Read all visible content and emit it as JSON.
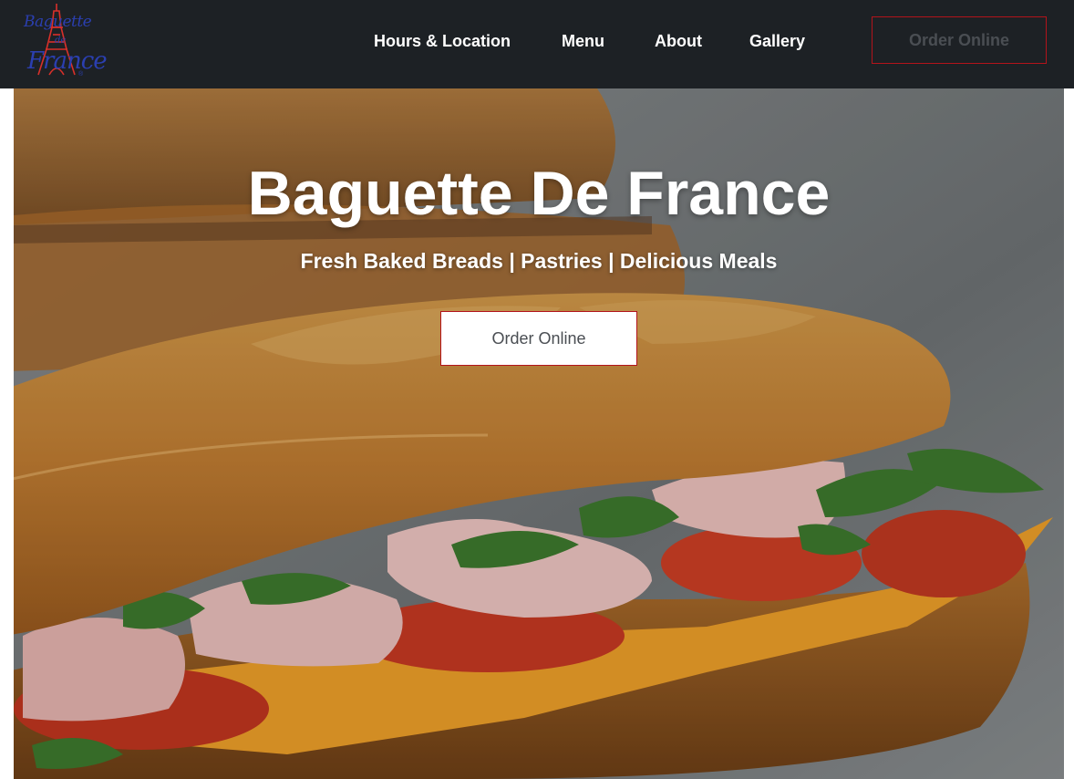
{
  "brand": {
    "logo_line1": "Baguette",
    "logo_line2": "de",
    "logo_line3": "France",
    "logo_mark": "®"
  },
  "nav": {
    "links": [
      {
        "label": "Hours & Location"
      },
      {
        "label": "Menu"
      },
      {
        "label": "About"
      },
      {
        "label": "Gallery"
      }
    ],
    "order_button": "Order Online"
  },
  "hero": {
    "title": "Baguette De France",
    "subtitle": "Fresh Baked Breads | Pastries | Delicious Meals",
    "button": "Order Online",
    "image_subject": "ham-cheese-tomato-baguette-sandwich"
  },
  "colors": {
    "navbar_bg": "#1d2125",
    "accent_border": "#b3141b",
    "logo_blue": "#2b3fb0",
    "logo_red": "#d9302a"
  }
}
